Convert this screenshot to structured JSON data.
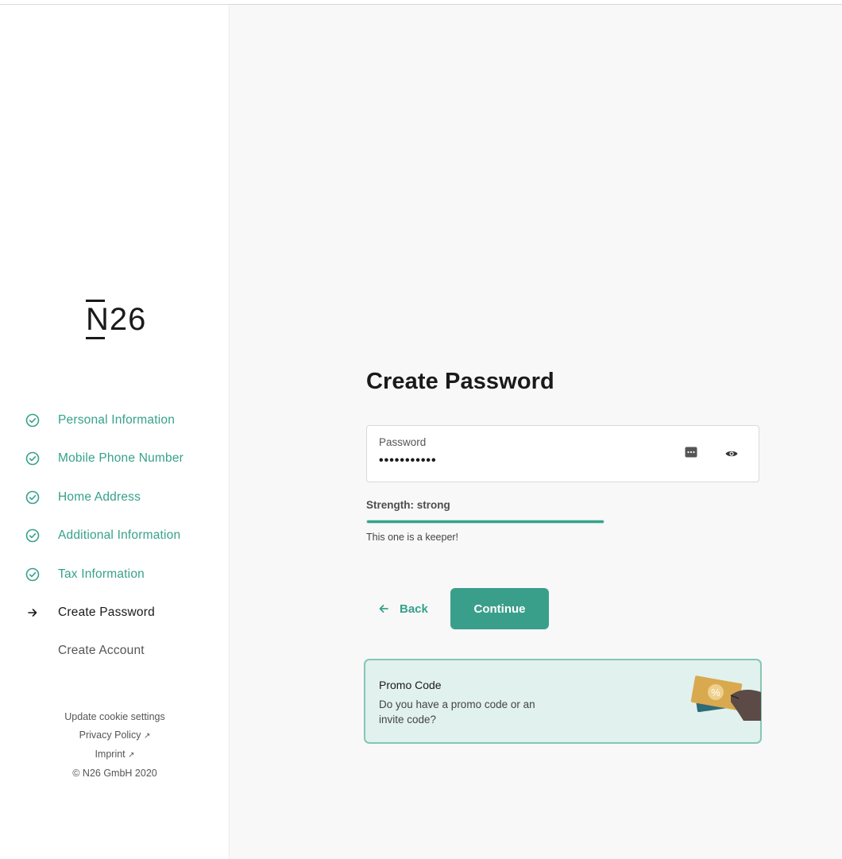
{
  "brand": {
    "logo_text": "N26"
  },
  "sidebar": {
    "steps": [
      {
        "label": "Personal Information",
        "status": "done",
        "icon": "check-circle-icon"
      },
      {
        "label": "Mobile Phone Number",
        "status": "done",
        "icon": "check-circle-icon"
      },
      {
        "label": "Home Address",
        "status": "done",
        "icon": "check-circle-icon"
      },
      {
        "label": "Additional Information",
        "status": "done",
        "icon": "check-circle-icon"
      },
      {
        "label": "Tax Information",
        "status": "done",
        "icon": "check-circle-icon"
      },
      {
        "label": "Create Password",
        "status": "current",
        "icon": "arrow-right-icon"
      },
      {
        "label": "Create Account",
        "status": "todo",
        "icon": ""
      }
    ],
    "footer": {
      "cookie": "Update cookie settings",
      "privacy": "Privacy Policy",
      "imprint": "Imprint",
      "external_glyph": "↗",
      "copyright": "© N26 GmbH 2020"
    }
  },
  "main": {
    "title": "Create Password",
    "password": {
      "label": "Password",
      "value": "•••••••••••",
      "key_icon": "password-manager-icon",
      "eye_icon": "eye-icon"
    },
    "strength": {
      "label": "Strength: strong",
      "level": 1.0,
      "message": "This one is a keeper!"
    },
    "buttons": {
      "back": "Back",
      "continue": "Continue"
    },
    "promo": {
      "title": "Promo Code",
      "description": "Do you have a promo code or an invite code?",
      "art_icon": "promo-ticket-illustration"
    }
  },
  "colors": {
    "accent": "#36a18b",
    "button": "#3a9f8a",
    "promo_bg": "#e1f1ed",
    "promo_border": "#86c6b6"
  }
}
